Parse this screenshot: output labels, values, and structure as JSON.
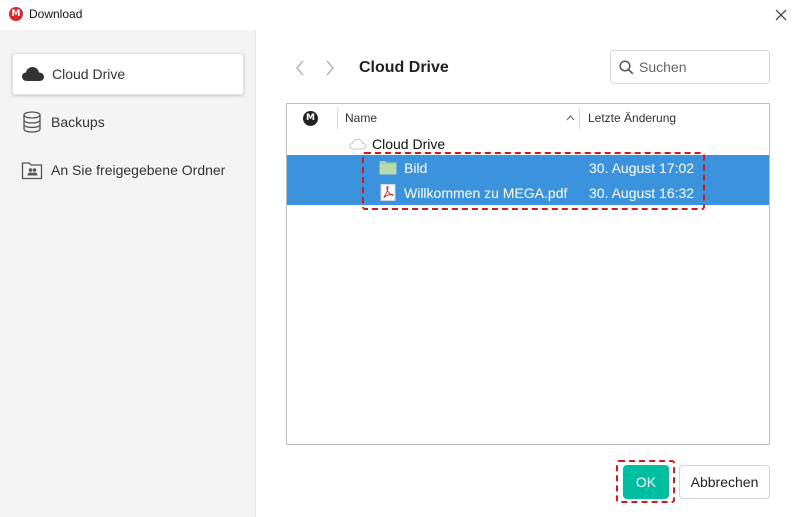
{
  "window": {
    "title": "Download",
    "logo_letter": "M",
    "close_glyph": "✕"
  },
  "sidebar": {
    "items": [
      {
        "label": "Cloud Drive",
        "icon": "cloud-icon",
        "active": true
      },
      {
        "label": "Backups",
        "icon": "database-icon",
        "active": false
      },
      {
        "label": "An Sie freigegebene Ordner",
        "icon": "shared-folder-icon",
        "active": false
      }
    ]
  },
  "header": {
    "title": "Cloud Drive",
    "search_placeholder": "Suchen"
  },
  "table": {
    "mega_column_letter": "M",
    "columns": [
      "Name",
      "Letzte Änderung"
    ],
    "root_label": "Cloud Drive",
    "rows": [
      {
        "name": "Bild",
        "date": "30. August 17:02",
        "icon": "folder-icon",
        "selected": true
      },
      {
        "name": "Willkommen zu MEGA.pdf",
        "date": "30. August 16:32",
        "icon": "pdf-file-icon",
        "selected": true
      }
    ]
  },
  "buttons": {
    "ok": "OK",
    "cancel": "Abbrechen"
  },
  "colors": {
    "selection": "#3b93dd",
    "ok_button": "#00bfa0",
    "highlight": "#d11a1a",
    "mega_red": "#d9272e"
  }
}
